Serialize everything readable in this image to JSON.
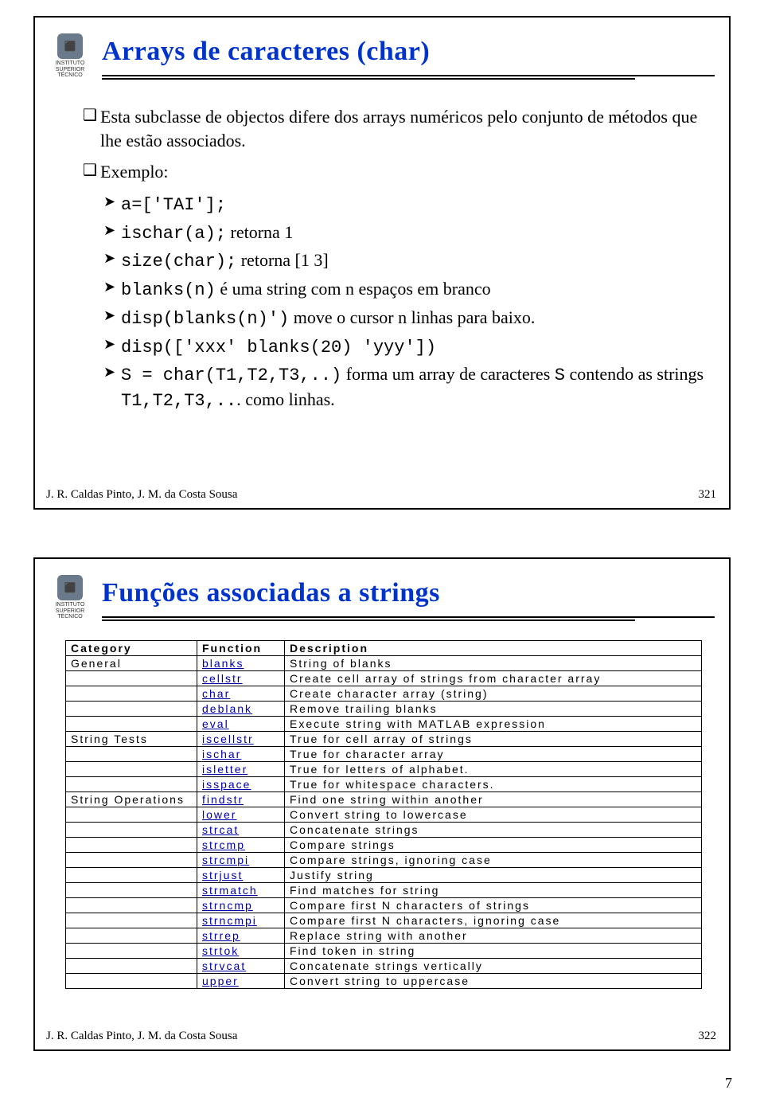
{
  "slide1": {
    "title": "Arrays de caracteres (char)",
    "bullets": [
      {
        "type": "sq",
        "text": "Esta subclasse de objectos difere dos arrays numéricos pelo conjunto de métodos que lhe estão associados."
      },
      {
        "type": "sq",
        "text": "Exemplo:"
      },
      {
        "type": "tri",
        "pre": "a=['TAI'];",
        "rest": ""
      },
      {
        "type": "tri",
        "pre": "ischar(a);",
        "rest": "   retorna 1"
      },
      {
        "type": "tri",
        "pre": "size(char);",
        "rest": "   retorna [1 3]"
      },
      {
        "type": "tri",
        "pre": "blanks(n)",
        "rest": " é uma string com n espaços em branco"
      },
      {
        "type": "tri",
        "pre": "disp(blanks(n)')",
        "rest": " move o cursor n linhas para baixo."
      },
      {
        "type": "tri",
        "pre": "disp(['xxx' blanks(20) 'yyy'])",
        "rest": ""
      },
      {
        "type": "tri2",
        "pre": "S = char(T1,T2,T3,..)",
        "mid": " forma  um array de caracteres ",
        "code2": "S",
        "rest2": " contendo as strings ",
        "code3": "T1,T2,T3,..",
        "rest3": ". como linhas."
      }
    ],
    "footer": "J. R. Caldas Pinto, J. M. da Costa Sousa",
    "pagenum": "321"
  },
  "slide2": {
    "title": "Funções associadas a strings",
    "headers": [
      "Category",
      "Function",
      "Description"
    ],
    "rows": [
      [
        "General",
        "blanks",
        "String of blanks"
      ],
      [
        "",
        "cellstr",
        "Create cell array of strings from character array"
      ],
      [
        "",
        "char",
        "Create character array (string)"
      ],
      [
        "",
        "deblank",
        "Remove trailing blanks"
      ],
      [
        "",
        "eval",
        "Execute string with MATLAB expression"
      ],
      [
        "String Tests",
        "iscellstr",
        "True for cell array of strings"
      ],
      [
        "",
        "ischar",
        "True for character array"
      ],
      [
        "",
        "isletter",
        "True for letters of alphabet."
      ],
      [
        "",
        "isspace",
        "True for whitespace characters."
      ],
      [
        "String Operations",
        "findstr",
        "Find one string within another"
      ],
      [
        "",
        "lower",
        "Convert string to lowercase"
      ],
      [
        "",
        "strcat",
        "Concatenate strings"
      ],
      [
        "",
        "strcmp",
        "Compare strings"
      ],
      [
        "",
        "strcmpi",
        "Compare strings, ignoring case"
      ],
      [
        "",
        "strjust",
        "Justify string"
      ],
      [
        "",
        "strmatch",
        "Find matches for string"
      ],
      [
        "",
        "strncmp",
        "Compare first N characters of strings"
      ],
      [
        "",
        "strncmpi",
        "Compare first N characters, ignoring case"
      ],
      [
        "",
        "strrep",
        "Replace string with another"
      ],
      [
        "",
        "strtok",
        "Find token in string"
      ],
      [
        "",
        "strvcat",
        "Concatenate strings vertically"
      ],
      [
        "",
        "upper",
        "Convert string to uppercase"
      ]
    ],
    "footer": "J. R. Caldas Pinto, J. M. da Costa Sousa",
    "pagenum": "322"
  },
  "logo_sub": "INSTITUTO SUPERIOR TÉCNICO",
  "doc_pagenum": "7"
}
